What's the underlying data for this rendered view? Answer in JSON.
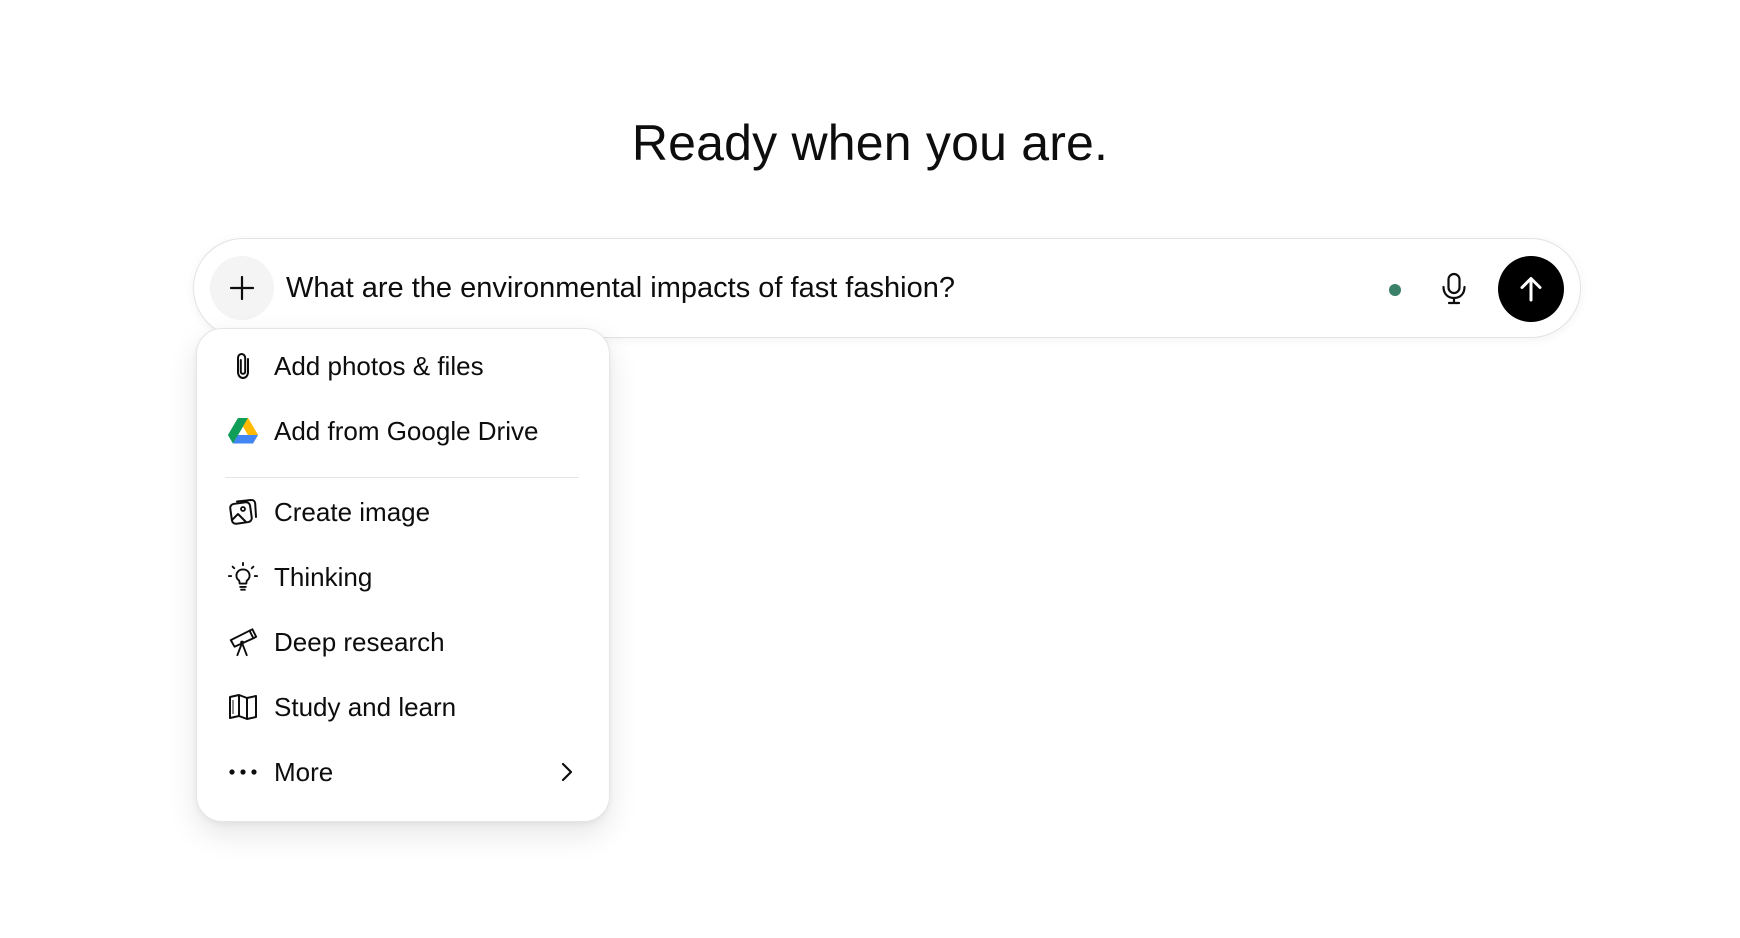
{
  "heading": "Ready when you are.",
  "composer": {
    "input_value": "What are the environmental impacts of fast fashion?",
    "plus_icon": "plus-icon",
    "mic_icon": "microphone-icon",
    "send_icon": "arrow-up-icon",
    "status_color": "#3b8068"
  },
  "menu": {
    "items": [
      {
        "label": "Add photos & files",
        "icon": "paperclip-icon"
      },
      {
        "label": "Add from Google Drive",
        "icon": "google-drive-icon"
      },
      {
        "label": "Create image",
        "icon": "image-icon"
      },
      {
        "label": "Thinking",
        "icon": "lightbulb-icon"
      },
      {
        "label": "Deep research",
        "icon": "telescope-icon"
      },
      {
        "label": "Study and learn",
        "icon": "book-icon"
      },
      {
        "label": "More",
        "icon": "ellipsis-icon"
      }
    ]
  }
}
